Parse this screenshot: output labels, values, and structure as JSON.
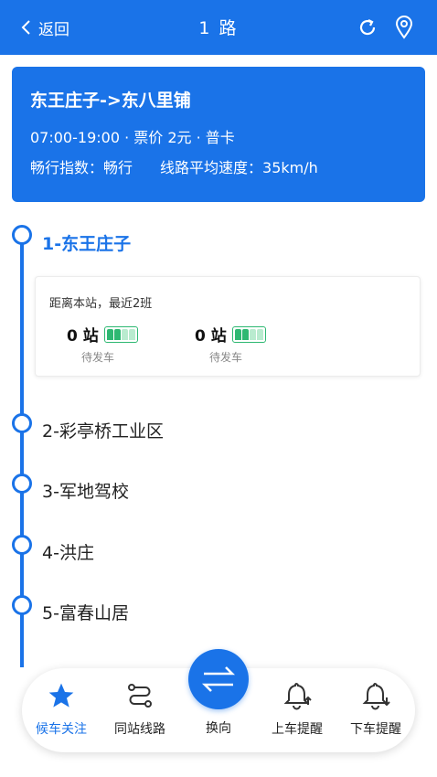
{
  "header": {
    "back_label": "返回",
    "title": "1 路",
    "refresh_icon": "refresh-icon",
    "location_icon": "location-pin-icon"
  },
  "route_card": {
    "route_name": "东王庄子->东八里铺",
    "info": "07:00-19:00 · 票价 2元 · 普卡",
    "traffic": "畅行指数：畅行",
    "avg_speed": "线路平均速度：35km/h"
  },
  "stops": [
    {
      "label": "1-东王庄子",
      "current": true
    },
    {
      "label": "2-彩亭桥工业区",
      "current": false
    },
    {
      "label": "3-军地驾校",
      "current": false
    },
    {
      "label": "4-洪庄",
      "current": false
    },
    {
      "label": "5-富春山居",
      "current": false
    }
  ],
  "arrivals": {
    "header": "距离本站，最近2班",
    "buses": [
      {
        "count": "0 站",
        "status": "待发车"
      },
      {
        "count": "0 站",
        "status": "待发车"
      }
    ]
  },
  "bottom_nav": {
    "tabs": [
      {
        "label": "候车关注",
        "icon": "star-icon",
        "active": true
      },
      {
        "label": "同站线路",
        "icon": "route-icon",
        "active": false
      },
      {
        "label": "换向",
        "icon": "swap-icon",
        "active": false
      },
      {
        "label": "上车提醒",
        "icon": "bell-up-icon",
        "active": false
      },
      {
        "label": "下车提醒",
        "icon": "bell-down-icon",
        "active": false
      }
    ]
  },
  "colors": {
    "primary": "#1a73e8",
    "seat_green": "#2eb872"
  }
}
